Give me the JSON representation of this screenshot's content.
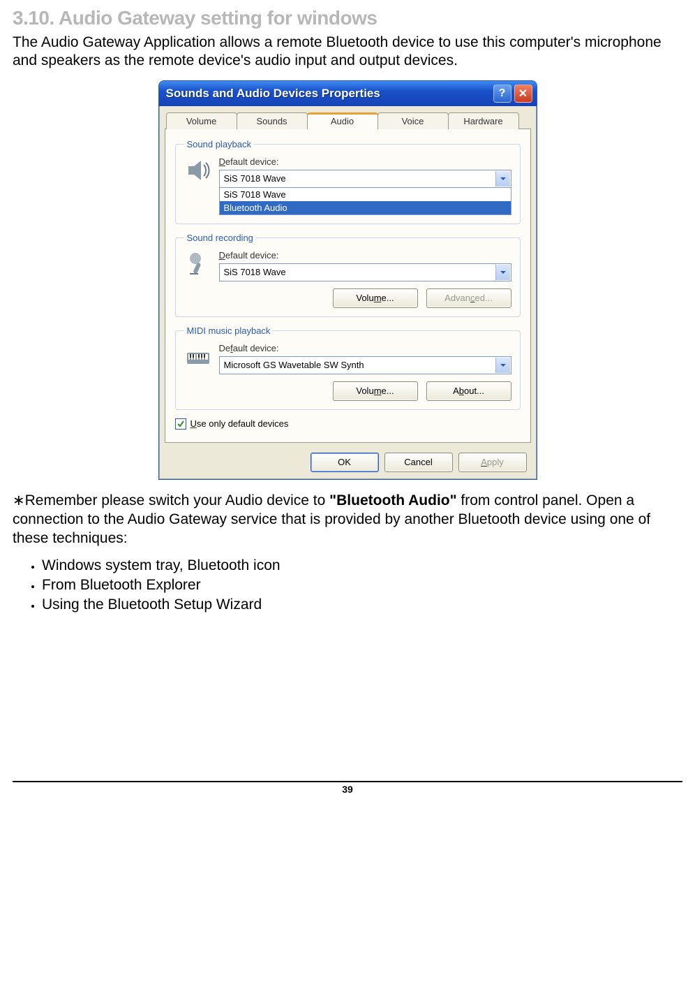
{
  "heading": "3.10. Audio Gateway setting for windows",
  "intro": "The Audio Gateway Application allows a remote Bluetooth device to use this computer's microphone and speakers as the remote device's audio input and output devices.",
  "window": {
    "title": "Sounds and Audio Devices Properties",
    "help_glyph": "?",
    "close_glyph": "✕",
    "tabs": {
      "volume": "Volume",
      "sounds": "Sounds",
      "audio": "Audio",
      "voice": "Voice",
      "hardware": "Hardware"
    },
    "playback": {
      "legend": "Sound playback",
      "label_prefix": "D",
      "label_rest": "efault device:",
      "value": "SiS 7018 Wave",
      "options": {
        "opt1": "SiS 7018 Wave",
        "opt2": "Bluetooth Audio"
      }
    },
    "recording": {
      "legend": "Sound recording",
      "label_prefix": "D",
      "label_rest": "efault device:",
      "value": "SiS 7018 Wave",
      "volume_btn_prefix": "Volu",
      "volume_btn_u": "m",
      "volume_btn_suffix": "e...",
      "advanced_btn_prefix": "Advan",
      "advanced_btn_u": "c",
      "advanced_btn_suffix": "ed..."
    },
    "midi": {
      "legend": "MIDI music playback",
      "label_prefix": "De",
      "label_u": "f",
      "label_rest": "ault device:",
      "value": "Microsoft GS Wavetable SW Synth",
      "volume_btn_prefix": "Volu",
      "volume_btn_u": "m",
      "volume_btn_suffix": "e...",
      "about_btn_prefix": "A",
      "about_btn_u": "b",
      "about_btn_suffix": "out..."
    },
    "use_only_default_u": "U",
    "use_only_default_rest": "se only default devices",
    "buttons": {
      "ok": "OK",
      "cancel": "Cancel",
      "apply_u": "A",
      "apply_rest": "pply"
    }
  },
  "note_prefix": "∗Remember please switch your Audio device to ",
  "note_bold": "\"Bluetooth Audio\"",
  "note_suffix": " from control panel. Open a connection to the Audio Gateway service that is provided by another Bluetooth device using one of these techniques:",
  "bullets": {
    "b1": "Windows system tray, Bluetooth icon",
    "b2": "From Bluetooth Explorer",
    "b3": "Using the Bluetooth Setup Wizard"
  },
  "page_number": "39"
}
